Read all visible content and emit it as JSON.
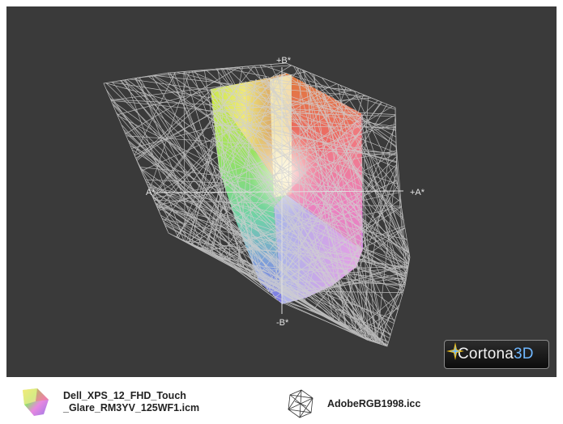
{
  "viewer": {
    "background": "#3a3a3a",
    "wire_color": "#d0d0d0",
    "axes": {
      "plus_b": "+B*",
      "minus_b": "-B*",
      "plus_a": "+A*",
      "minus_a": "A*"
    }
  },
  "logo": {
    "text_main": "Cortona",
    "text_accent": "3D",
    "icon": "cortona-star-icon"
  },
  "legend": {
    "items": [
      {
        "line1": "Dell_XPS_12_FHD_Touch",
        "line2": "_Glare_RM3YV_125WF1.icm",
        "icon": "color-gamut-solid-icon"
      },
      {
        "label": "AdobeRGB1998.icc",
        "icon": "wireframe-gamut-icon"
      }
    ]
  }
}
